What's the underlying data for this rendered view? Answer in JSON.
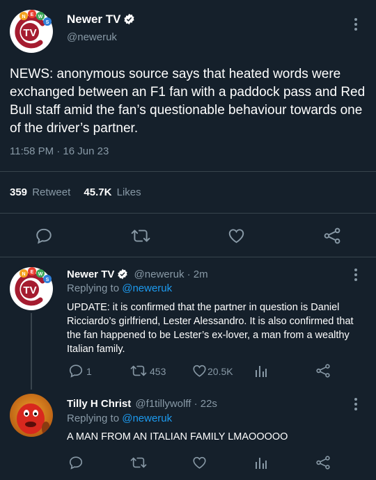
{
  "main_tweet": {
    "display_name": "Newer TV",
    "handle": "@neweruk",
    "text": "NEWS: anonymous source says that heated words were exchanged between an F1 fan with a paddock pass and Red Bull staff amid the fan’s questionable behaviour towards one of the driver’s partner.",
    "timestamp": "11:58 PM · 16 Jun 23",
    "retweet_count": "359",
    "retweet_label": "Retweet",
    "likes_count": "45.7K",
    "likes_label": "Likes"
  },
  "avatar": {
    "logo_text": "TV",
    "bubbles": [
      "N",
      "E",
      "W",
      "S"
    ]
  },
  "reply1": {
    "display_name": "Newer TV",
    "handle_time": "@neweruk · 2m",
    "replying_prefix": "Replying to ",
    "replying_handle": "@neweruk",
    "text": "UPDATE: it is confirmed that the partner in question is Daniel Ricciardo’s girlfriend, Lester Alessandro. It is also confirmed that the fan happened to be Lester’s ex-lover, a man from a wealthy Italian family.",
    "reply_count": "1",
    "retweet_count": "453",
    "like_count": "20.5K"
  },
  "reply2": {
    "display_name": "Tilly H Christ",
    "handle_time": "@f1tillywolff · 22s",
    "replying_prefix": "Replying to ",
    "replying_handle": "@neweruk",
    "text": "A MAN FROM AN ITALIAN FAMILY LMAOOOOO"
  },
  "colors": {
    "background": "#15202b",
    "muted": "#8899a6",
    "link": "#1d9bf0",
    "divider": "#38444d",
    "logo_red": "#a51c30"
  },
  "icons": [
    "reply-icon",
    "retweet-icon",
    "like-icon",
    "share-icon",
    "analytics-icon",
    "more-icon",
    "verified-badge-icon"
  ]
}
